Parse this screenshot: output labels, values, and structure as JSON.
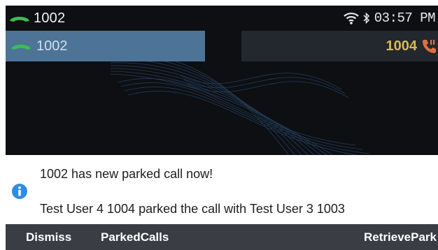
{
  "status_bar": {
    "line_number": "1002",
    "time": "03:57 PM"
  },
  "calls": {
    "active": {
      "number": "1002"
    },
    "held": {
      "number": "1004"
    }
  },
  "notification": {
    "title": "1002 has new parked call now!",
    "message": "Test User 4 1004 parked the call with Test User 3 1003"
  },
  "softkeys": {
    "dismiss": "Dismiss",
    "parked_calls": "ParkedCalls",
    "retrieve_park": "RetrievePark"
  },
  "colors": {
    "call_green": "#3bbf4f",
    "held_orange": "#e0703a",
    "held_number": "#d6bb54",
    "active_tab": "#4d7497",
    "info_blue": "#2f8de4",
    "softkey_bar": "#3a3d43"
  },
  "icons": {
    "line_status": "handset-icon",
    "wifi": "wifi-icon",
    "bluetooth": "bluetooth-icon",
    "active_call": "handset-icon",
    "held_call": "call-hold-icon",
    "notification": "info-icon"
  }
}
